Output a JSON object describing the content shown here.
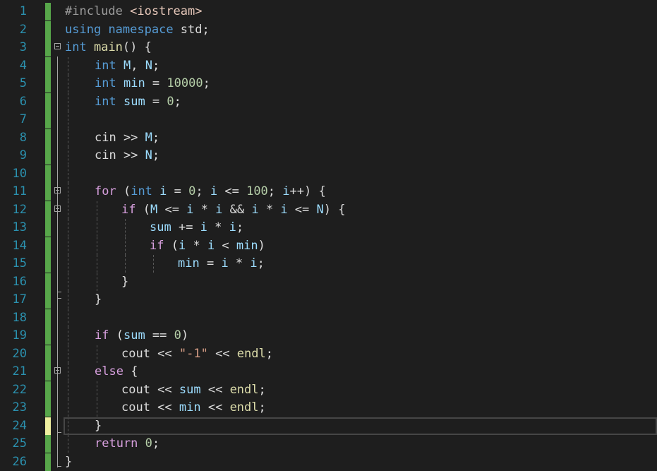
{
  "editor": {
    "line_numbers": [
      "1",
      "2",
      "3",
      "4",
      "5",
      "6",
      "7",
      "8",
      "9",
      "10",
      "11",
      "12",
      "13",
      "14",
      "15",
      "16",
      "17",
      "18",
      "19",
      "20",
      "21",
      "22",
      "23",
      "24",
      "25",
      "26"
    ],
    "lines": [
      {
        "indent": 0,
        "tokens": [
          [
            "pp",
            "#include "
          ],
          [
            "inc",
            "<iostream>"
          ]
        ]
      },
      {
        "indent": 0,
        "tokens": [
          [
            "kw",
            "using"
          ],
          [
            "pl",
            " "
          ],
          [
            "kw",
            "namespace"
          ],
          [
            "pl",
            " std;"
          ]
        ]
      },
      {
        "indent": 0,
        "tokens": [
          [
            "kw",
            "int"
          ],
          [
            "pl",
            " "
          ],
          [
            "fn",
            "main"
          ],
          [
            "pl",
            "() {"
          ]
        ]
      },
      {
        "indent": 1,
        "tokens": [
          [
            "kw",
            "int"
          ],
          [
            "pl",
            " "
          ],
          [
            "id",
            "M"
          ],
          [
            "pl",
            ", "
          ],
          [
            "id",
            "N"
          ],
          [
            "pl",
            ";"
          ]
        ]
      },
      {
        "indent": 1,
        "tokens": [
          [
            "kw",
            "int"
          ],
          [
            "pl",
            " "
          ],
          [
            "id",
            "min"
          ],
          [
            "pl",
            " = "
          ],
          [
            "num",
            "10000"
          ],
          [
            "pl",
            ";"
          ]
        ]
      },
      {
        "indent": 1,
        "tokens": [
          [
            "kw",
            "int"
          ],
          [
            "pl",
            " "
          ],
          [
            "id",
            "sum"
          ],
          [
            "pl",
            " = "
          ],
          [
            "num",
            "0"
          ],
          [
            "pl",
            ";"
          ]
        ]
      },
      {
        "indent": 1,
        "tokens": []
      },
      {
        "indent": 1,
        "tokens": [
          [
            "pl",
            "cin >> "
          ],
          [
            "id",
            "M"
          ],
          [
            "pl",
            ";"
          ]
        ]
      },
      {
        "indent": 1,
        "tokens": [
          [
            "pl",
            "cin >> "
          ],
          [
            "id",
            "N"
          ],
          [
            "pl",
            ";"
          ]
        ]
      },
      {
        "indent": 1,
        "tokens": []
      },
      {
        "indent": 1,
        "tokens": [
          [
            "ctrl",
            "for"
          ],
          [
            "pl",
            " ("
          ],
          [
            "kw",
            "int"
          ],
          [
            "pl",
            " "
          ],
          [
            "id",
            "i"
          ],
          [
            "pl",
            " = "
          ],
          [
            "num",
            "0"
          ],
          [
            "pl",
            "; "
          ],
          [
            "id",
            "i"
          ],
          [
            "pl",
            " <= "
          ],
          [
            "num",
            "100"
          ],
          [
            "pl",
            "; "
          ],
          [
            "id",
            "i"
          ],
          [
            "pl",
            "++) {"
          ]
        ]
      },
      {
        "indent": 2,
        "tokens": [
          [
            "ctrl",
            "if"
          ],
          [
            "pl",
            " ("
          ],
          [
            "id",
            "M"
          ],
          [
            "pl",
            " <= "
          ],
          [
            "id",
            "i"
          ],
          [
            "pl",
            " * "
          ],
          [
            "id",
            "i"
          ],
          [
            "pl",
            " && "
          ],
          [
            "id",
            "i"
          ],
          [
            "pl",
            " * "
          ],
          [
            "id",
            "i"
          ],
          [
            "pl",
            " <= "
          ],
          [
            "id",
            "N"
          ],
          [
            "pl",
            ") {"
          ]
        ]
      },
      {
        "indent": 3,
        "tokens": [
          [
            "id",
            "sum"
          ],
          [
            "pl",
            " += "
          ],
          [
            "id",
            "i"
          ],
          [
            "pl",
            " * "
          ],
          [
            "id",
            "i"
          ],
          [
            "pl",
            ";"
          ]
        ]
      },
      {
        "indent": 3,
        "tokens": [
          [
            "ctrl",
            "if"
          ],
          [
            "pl",
            " ("
          ],
          [
            "id",
            "i"
          ],
          [
            "pl",
            " * "
          ],
          [
            "id",
            "i"
          ],
          [
            "pl",
            " < "
          ],
          [
            "id",
            "min"
          ],
          [
            "pl",
            ")"
          ]
        ]
      },
      {
        "indent": 4,
        "tokens": [
          [
            "id",
            "min"
          ],
          [
            "pl",
            " = "
          ],
          [
            "id",
            "i"
          ],
          [
            "pl",
            " * "
          ],
          [
            "id",
            "i"
          ],
          [
            "pl",
            ";"
          ]
        ]
      },
      {
        "indent": 2,
        "tokens": [
          [
            "pl",
            "}"
          ]
        ]
      },
      {
        "indent": 1,
        "tokens": [
          [
            "pl",
            "}"
          ]
        ]
      },
      {
        "indent": 1,
        "tokens": []
      },
      {
        "indent": 1,
        "tokens": [
          [
            "ctrl",
            "if"
          ],
          [
            "pl",
            " ("
          ],
          [
            "id",
            "sum"
          ],
          [
            "pl",
            " == "
          ],
          [
            "num",
            "0"
          ],
          [
            "pl",
            ")"
          ]
        ]
      },
      {
        "indent": 2,
        "tokens": [
          [
            "pl",
            "cout << "
          ],
          [
            "str",
            "\"-1\""
          ],
          [
            "pl",
            " << "
          ],
          [
            "fn",
            "endl"
          ],
          [
            "pl",
            ";"
          ]
        ]
      },
      {
        "indent": 1,
        "tokens": [
          [
            "ctrl",
            "else"
          ],
          [
            "pl",
            " {"
          ]
        ]
      },
      {
        "indent": 2,
        "tokens": [
          [
            "pl",
            "cout << "
          ],
          [
            "id",
            "sum"
          ],
          [
            "pl",
            " << "
          ],
          [
            "fn",
            "endl"
          ],
          [
            "pl",
            ";"
          ]
        ]
      },
      {
        "indent": 2,
        "tokens": [
          [
            "pl",
            "cout << "
          ],
          [
            "id",
            "min"
          ],
          [
            "pl",
            " << "
          ],
          [
            "fn",
            "endl"
          ],
          [
            "pl",
            ";"
          ]
        ]
      },
      {
        "indent": 1,
        "tokens": [
          [
            "pl",
            "}"
          ]
        ]
      },
      {
        "indent": 1,
        "tokens": [
          [
            "ctrl",
            "return"
          ],
          [
            "pl",
            " "
          ],
          [
            "num",
            "0"
          ],
          [
            "pl",
            ";"
          ]
        ]
      },
      {
        "indent": 0,
        "tokens": [
          [
            "pl",
            "}"
          ]
        ]
      }
    ],
    "current_line": "24",
    "fold_lines": [
      "3",
      "11",
      "12",
      "21"
    ]
  }
}
